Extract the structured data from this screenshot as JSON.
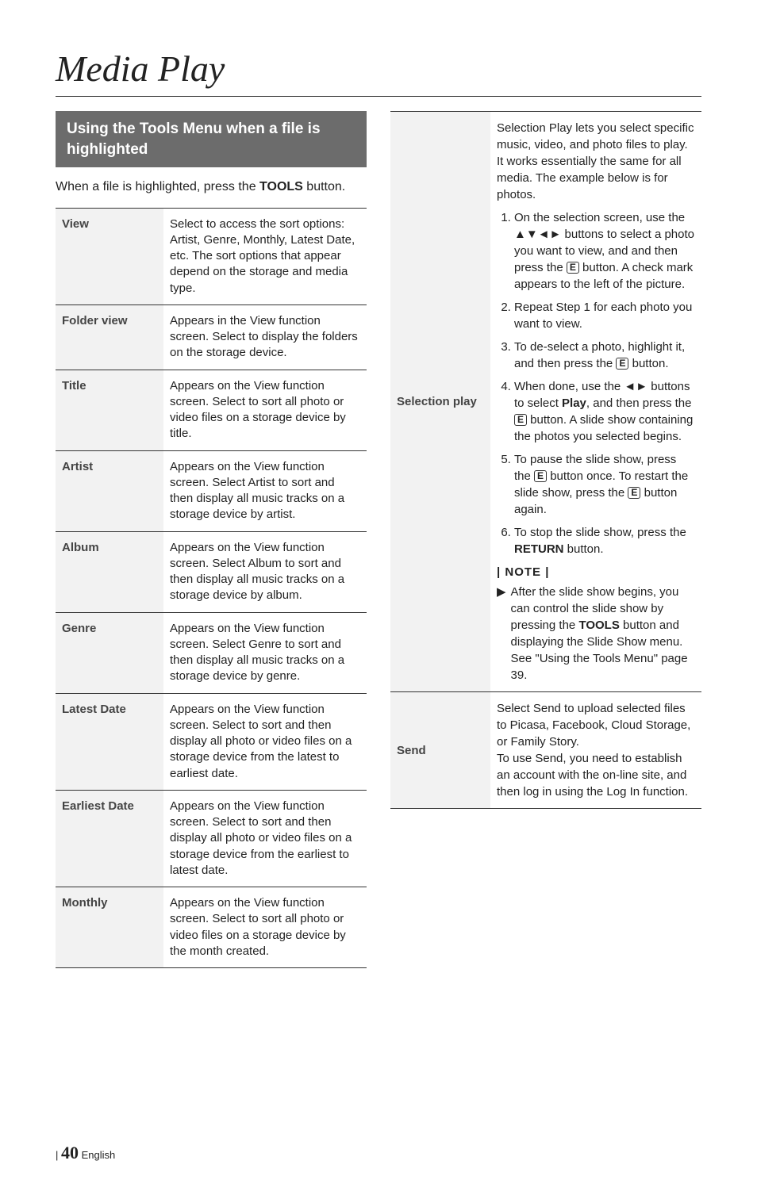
{
  "page": {
    "title": "Media Play",
    "subheading": "Using the Tools Menu when a file is highlighted",
    "lead_pre": "When a file is highlighted, press the ",
    "lead_bold": "TOOLS",
    "lead_post": " button.",
    "page_number": "40",
    "page_lang": "English"
  },
  "left_table": [
    {
      "label": "View",
      "desc": "Select to access the sort options: Artist, Genre, Monthly, Latest Date, etc. The sort options that appear depend on the storage and media type."
    },
    {
      "label": "Folder view",
      "desc": "Appears in the View function screen. Select to display the folders on the storage device."
    },
    {
      "label": "Title",
      "desc": "Appears on the View function screen. Select to sort all photo or video files on a storage device by title."
    },
    {
      "label": "Artist",
      "desc": "Appears on the View function screen. Select Artist to sort and then display all music tracks on a storage device by artist."
    },
    {
      "label": "Album",
      "desc": "Appears on the View function screen. Select Album to sort and then display all music tracks on a storage device by album."
    },
    {
      "label": "Genre",
      "desc": "Appears on the View function screen. Select Genre to sort and then display all music tracks on a storage device by genre."
    },
    {
      "label": "Latest Date",
      "desc": "Appears on the View function screen. Select to sort and then display all photo or video files on a storage device from the latest to earliest date."
    },
    {
      "label": "Earliest Date",
      "desc": "Appears on the View function screen. Select to sort and then display all photo or video files on a storage device from the earliest to latest date."
    },
    {
      "label": "Monthly",
      "desc": "Appears on the View function screen. Select to sort all photo or video files on a storage device by the month created."
    }
  ],
  "selection_play": {
    "label": "Selection play",
    "intro": "Selection Play lets you select specific music, video, and photo files to play. It works essentially the same for all media. The example below is for photos.",
    "step1_a": "On the selection screen, use the ▲▼◄► buttons to select a photo you want to view, and and then press the ",
    "step1_b": " button. A check mark appears to the left of the picture.",
    "step2": "Repeat Step 1 for each photo you want to view.",
    "step3_a": "To de-select a photo, highlight it, and then press the ",
    "step3_b": " button.",
    "step4_a": "When done, use the ◄► buttons to select ",
    "step4_play": "Play",
    "step4_b": ", and then press the ",
    "step4_c": " button. A slide show containing the photos you selected begins.",
    "step5_a": "To pause the slide show, press the ",
    "step5_b": " button once. To restart the slide show, press the ",
    "step5_c": " button again.",
    "step6_a": "To stop the slide show, press the ",
    "step6_return": "RETURN",
    "step6_b": " button.",
    "note_label": "| NOTE |",
    "note_a": "After the slide show begins, you can control the slide show by pressing the ",
    "note_tools": "TOOLS",
    "note_b": " button and displaying the Slide Show menu. See \"Using the Tools Menu\" page 39."
  },
  "send": {
    "label": "Send",
    "desc1": "Select Send to upload selected files to Picasa, Facebook, Cloud Storage, or Family Story.",
    "desc2": "To use Send, you need to establish an account with the on-line site, and then log in using the Log In function."
  },
  "icons": {
    "enter": "E"
  }
}
